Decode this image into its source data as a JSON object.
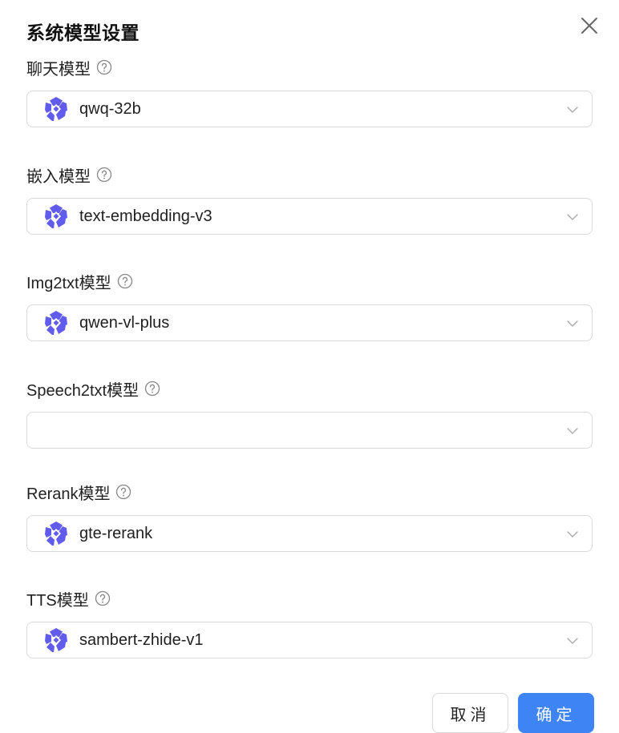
{
  "dialog": {
    "title": "系统模型设置",
    "fields": [
      {
        "label": "聊天模型",
        "value": "qwq-32b",
        "has_logo": true
      },
      {
        "label": "嵌入模型",
        "value": "text-embedding-v3",
        "has_logo": true
      },
      {
        "label": "Img2txt模型",
        "value": "qwen-vl-plus",
        "has_logo": true
      },
      {
        "label": "Speech2txt模型",
        "value": "",
        "has_logo": false
      },
      {
        "label": "Rerank模型",
        "value": "gte-rerank",
        "has_logo": true
      },
      {
        "label": "TTS模型",
        "value": "sambert-zhide-v1",
        "has_logo": true
      }
    ],
    "cancel_label": "取消",
    "ok_label": "确定"
  },
  "icons": {
    "close": "close-icon",
    "help": "question-circle-icon",
    "dropdown": "chevron-down-icon",
    "provider_logo": "tongyi-qwen-logo"
  },
  "colors": {
    "primary": "#3f84f5",
    "logo": "#615ced",
    "border": "#d9d9d9"
  }
}
